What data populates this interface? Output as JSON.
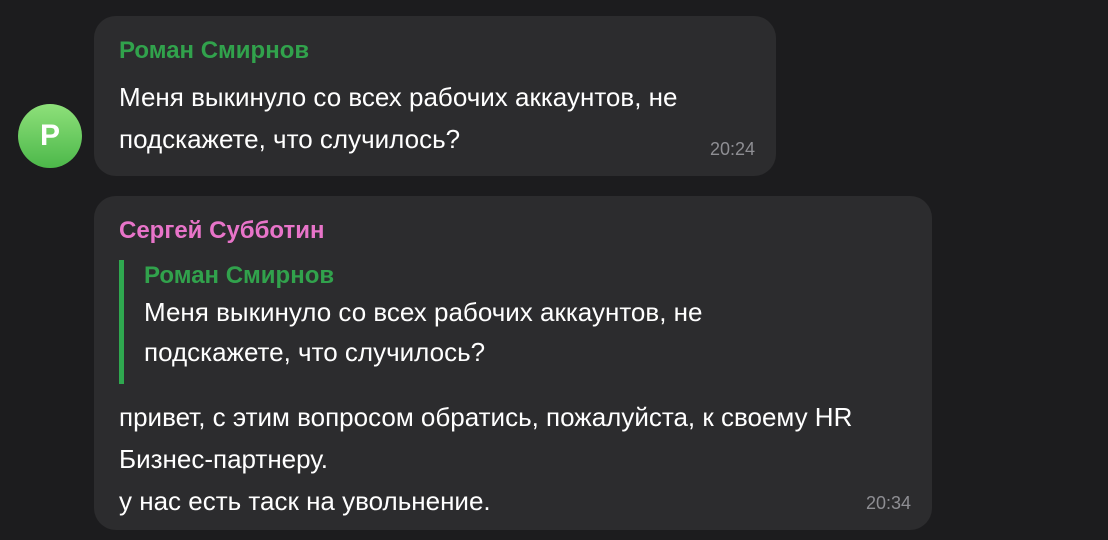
{
  "messages": [
    {
      "avatar_letter": "Р",
      "sender": "Роман Смирнов",
      "text": "Меня выкинуло со всех рабочих аккаунтов, не подскажете, что случилось?",
      "time": "20:24"
    },
    {
      "sender": "Сергей Субботин",
      "reply_to": {
        "sender": "Роман Смирнов",
        "text": "Меня выкинуло со всех рабочих аккаунтов, не подскажете, что случилось?"
      },
      "lines": [
        "привет, с этим вопросом обратись, пожалуйста, к своему HR Бизнес-партнеру.",
        "у нас есть таск на увольнение."
      ],
      "time": "20:34"
    }
  ],
  "colors": {
    "background": "#1c1c1e",
    "bubble": "#2c2c2e",
    "sender_green": "#31a24c",
    "sender_pink": "#e874c9",
    "quote_bar": "#2fa84f",
    "time": "#8e8e93"
  }
}
